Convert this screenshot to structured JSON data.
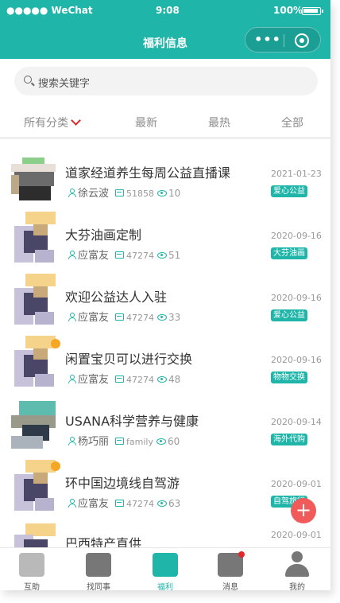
{
  "status_bar": {
    "carrier": "●●●●● WeChat",
    "time": "9:08",
    "battery": "100%"
  },
  "header": {
    "title": "福利信息",
    "more": "•••"
  },
  "search": {
    "placeholder": "搜索关键字"
  },
  "tabs": [
    {
      "label": "所有分类"
    },
    {
      "label": "最新"
    },
    {
      "label": "最热"
    },
    {
      "label": "全部"
    }
  ],
  "items": [
    {
      "title": "道家经道养生每周公益直播课",
      "author": "徐云波",
      "code": "51858",
      "views": "10",
      "date": "2021-01-23",
      "tag": "爱心公益"
    },
    {
      "title": "大芬油画定制",
      "author": "应富友",
      "code": "47274",
      "views": "51",
      "date": "2020-09-16",
      "tag": "大芬油画"
    },
    {
      "title": "欢迎公益达人入驻",
      "author": "应富友",
      "code": "47274",
      "views": "33",
      "date": "2020-09-16",
      "tag": "爱心公益"
    },
    {
      "title": "闲置宝贝可以进行交换",
      "author": "应富友",
      "code": "47274",
      "views": "48",
      "date": "2020-09-16",
      "tag": "物物交换"
    },
    {
      "title": "USANA科学营养与健康",
      "author": "杨巧丽",
      "code": "family",
      "views": "60",
      "date": "2020-09-14",
      "tag": "海外代购"
    },
    {
      "title": "环中国边境线自驾游",
      "author": "应富友",
      "code": "47274",
      "views": "63",
      "date": "2020-09-01",
      "tag": "自驾旅行"
    },
    {
      "title": "巴西特产直供",
      "author": "",
      "code": "",
      "views": "",
      "date": "2020-09-01",
      "tag": ""
    }
  ],
  "fab": {
    "label": "+"
  },
  "nav": [
    {
      "label": "互助"
    },
    {
      "label": "找同事"
    },
    {
      "label": "福利"
    },
    {
      "label": "消息"
    },
    {
      "label": "我的"
    }
  ],
  "colors": {
    "accent": "#1fb5a9",
    "chevron": "#e02a2a",
    "fab": "#f05a5a"
  }
}
